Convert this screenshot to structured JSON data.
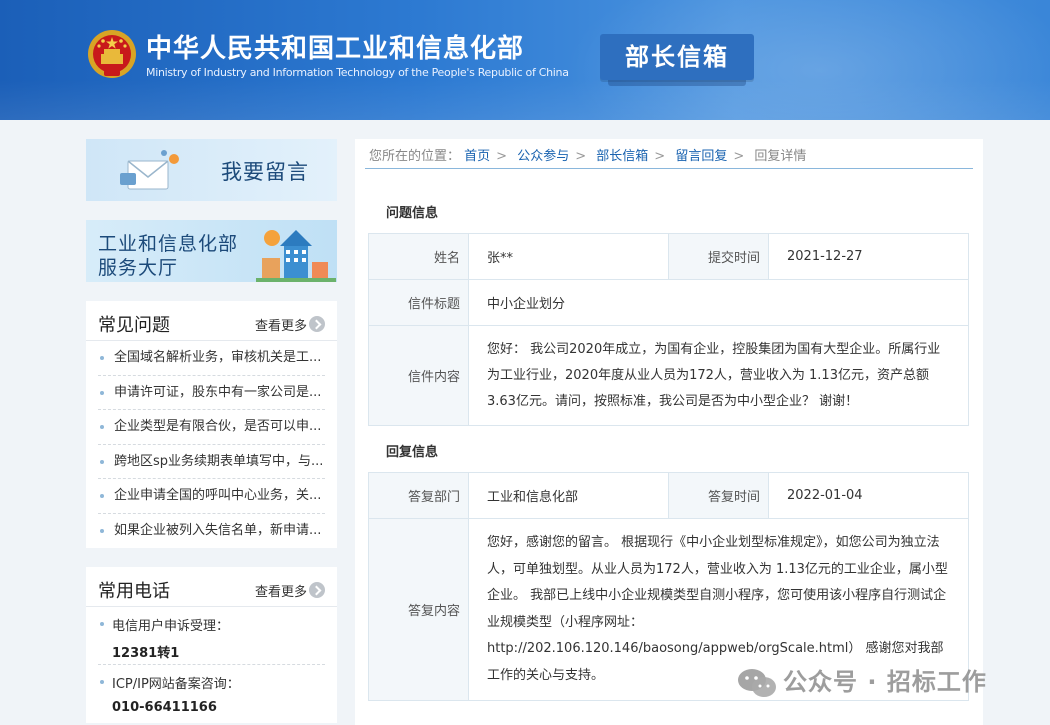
{
  "header": {
    "ministry_cn": "中华人民共和国工业和信息化部",
    "ministry_en": "Ministry of Industry and Information Technology of the People's Republic of China",
    "mailbox_tab": "部长信箱"
  },
  "sidebar": {
    "leave_message": "我要留言",
    "service_hall_line1": "工业和信息化部",
    "service_hall_line2": "服务大厅",
    "faq": {
      "title": "常见问题",
      "more": "查看更多",
      "items": [
        "全国域名解析业务，审核机关是工...",
        "申请许可证，股东中有一家公司是...",
        "企业类型是有限合伙，是否可以申...",
        "跨地区sp业务续期表单填写中，与...",
        "企业申请全国的呼叫中心业务，关...",
        "如果企业被列入失信名单，新申请..."
      ]
    },
    "phones": {
      "title": "常用电话",
      "more": "查看更多",
      "items": [
        {
          "label": "电信用户申诉受理：",
          "number": "12381转1"
        },
        {
          "label": "ICP/IP网站备案咨询：",
          "number": "010-66411166"
        }
      ]
    }
  },
  "breadcrumb": {
    "prefix": "您所在的位置：",
    "links": [
      "首页",
      "公众参与",
      "部长信箱",
      "留言回复"
    ],
    "current": "回复详情"
  },
  "question": {
    "section_title": "问题信息",
    "name_label": "姓名",
    "name_value": "张**",
    "date_label": "提交时间",
    "date_value": "2021-12-27",
    "subject_label": "信件标题",
    "subject_value": "中小企业划分",
    "content_label": "信件内容",
    "content_value": "您好：  我公司2020年成立，为国有企业，控股集团为国有大型企业。所属行业为工业行业，2020年度从业人员为172人，营业收入为 1.13亿元，资产总额3.63亿元。请问，按照标准，我公司是否为中小型企业？ 谢谢！"
  },
  "reply": {
    "section_title": "回复信息",
    "dept_label": "答复部门",
    "dept_value": "工业和信息化部",
    "date_label": "答复时间",
    "date_value": "2022-01-04",
    "content_label": "答复内容",
    "content_value": "您好，感谢您的留言。 根据现行《中小企业划型标准规定》，如您公司为独立法人，可单独划型。从业人员为172人，营业收入为 1.13亿元的工业企业，属小型企业。 我部已上线中小企业规模类型自测小程序，您可使用该小程序自行测试企业规模类型（小程序网址：http://202.106.120.146/baosong/appweb/orgScale.html） 感谢您对我部工作的关心与支持。"
  },
  "watermark": "公众号 · 招标工作"
}
